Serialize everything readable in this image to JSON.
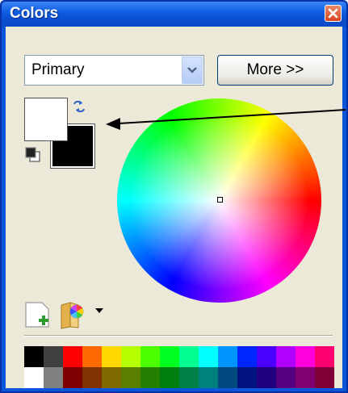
{
  "window": {
    "title": "Colors"
  },
  "combo": {
    "value": "Primary"
  },
  "buttons": {
    "more": "More >>"
  },
  "colors": {
    "primary": "#ffffff",
    "secondary": "#000000",
    "titlebar": "#0a55d8",
    "close": "#d7451f"
  },
  "palette": {
    "row1": [
      "#000000",
      "#404040",
      "#ff0000",
      "#ff6a00",
      "#ffd800",
      "#b6ff00",
      "#4cff00",
      "#00ff21",
      "#00ff90",
      "#00ffff",
      "#0094ff",
      "#0026ff",
      "#4800ff",
      "#b200ff",
      "#ff00dc",
      "#ff006e"
    ],
    "row2": [
      "#ffffff",
      "#808080",
      "#7f0000",
      "#7f3300",
      "#7f6a00",
      "#5b7f00",
      "#267f00",
      "#007f0e",
      "#007f46",
      "#007f7f",
      "#004a7f",
      "#00137f",
      "#21007f",
      "#57007f",
      "#7f006e",
      "#7f0037"
    ]
  },
  "icons": {
    "close": "close-icon",
    "dropdown": "chevron-down-icon",
    "swap": "swap-colors-icon",
    "reset": "reset-colors-icon",
    "add": "add-color-icon",
    "palette": "palette-icon",
    "menu": "menu-dropdown-icon"
  }
}
